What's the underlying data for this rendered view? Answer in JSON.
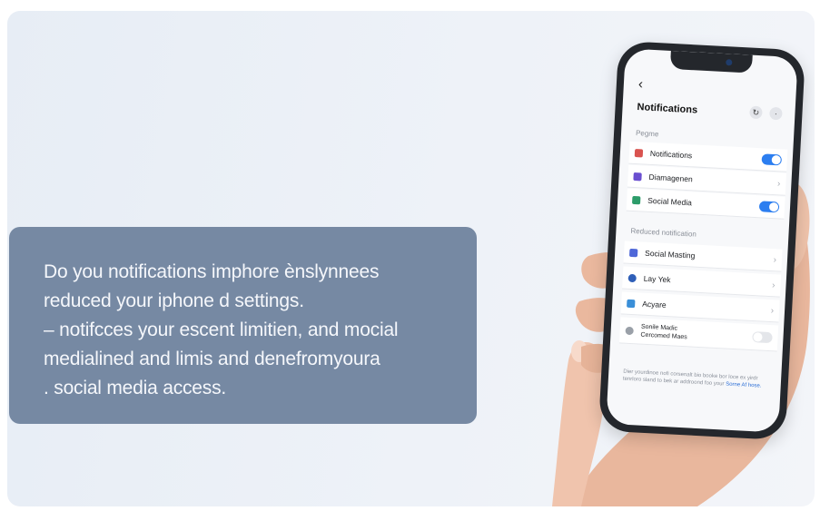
{
  "caption": {
    "lines": [
      "Do you notifications imphore ènslynnees",
      "reduced your iphone d settings.",
      "– notifcces your escent limitien, and mocial",
      "medialined and limis and denefromyoura",
      ". social media access."
    ]
  },
  "phone": {
    "back_glyph": "‹",
    "nav_title": "Notifications",
    "nav_icons": [
      "refresh-icon",
      "info-icon"
    ],
    "nav_icon_glyphs": [
      "↻",
      "·"
    ],
    "section1_label": "Pegme",
    "section1_rows": [
      {
        "label": "Notifications",
        "icon": "shield-icon",
        "icon_color": "#d9534f",
        "control": "toggle-on"
      },
      {
        "label": "Diamagenen",
        "icon": "grid-icon",
        "icon_color": "#6a4fd0",
        "control": "chevron"
      },
      {
        "label": "Social Media",
        "icon": "social-icon",
        "icon_color": "#2d9c6a",
        "control": "toggle-on"
      }
    ],
    "section2_label": "Reduced notification",
    "section2_rows": [
      {
        "label": "Social Masting",
        "icon": "message-icon",
        "icon_color": "#4e67d8",
        "control": "chevron"
      },
      {
        "label": "Lay Yek",
        "icon": "facebook-icon",
        "icon_color": "#2f5fb8",
        "control": "chevron"
      },
      {
        "label": "Acyare",
        "icon": "app-icon",
        "icon_color": "#3a8fd8",
        "control": "chevron"
      },
      {
        "label_line1": "Sonile Madic",
        "label_line2": "Cercomed Maes",
        "icon": "circle-icon",
        "icon_color": "#9aa0a8",
        "control": "toggle-off"
      }
    ],
    "chevron_glyph": "›",
    "footer_note": "Dier yourdinoe nofi corsenalt bio booke bor loce ex yirdr tenrloro sland to bek ar addroond foo your",
    "footer_link": "Sorne Af hose."
  },
  "colors": {
    "caption_bg": "#7689a3",
    "toggle_on": "#2c7ef0",
    "phone_frame": "#24272c"
  }
}
